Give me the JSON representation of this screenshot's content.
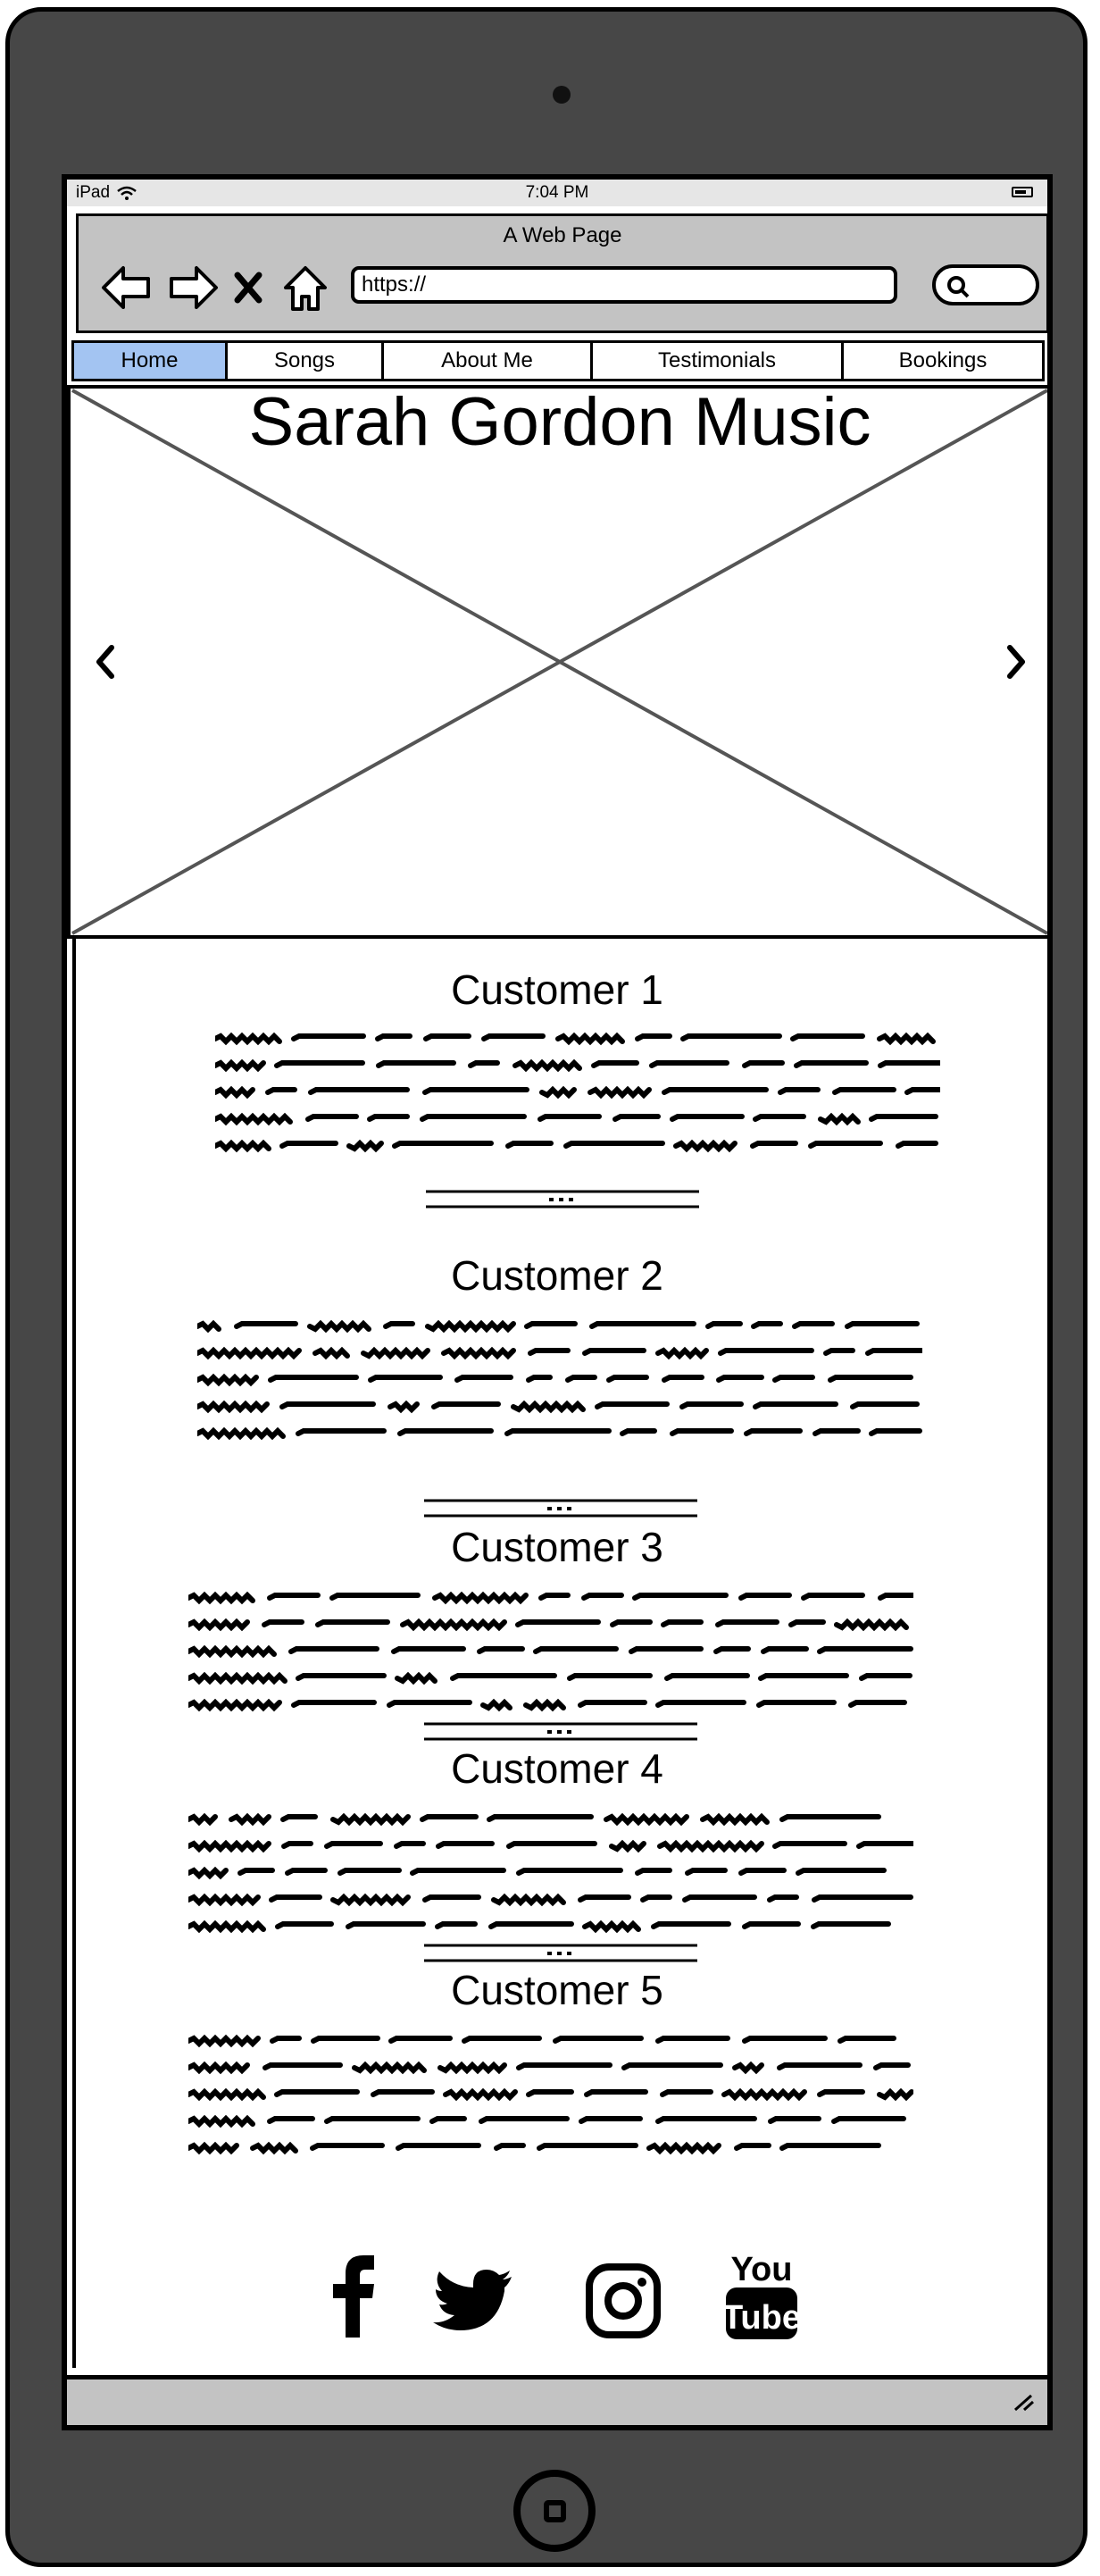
{
  "status_bar": {
    "device": "iPad",
    "time": "7:04 PM"
  },
  "browser": {
    "page_title": "A Web Page",
    "url": "https://",
    "icons": [
      "back-arrow-icon",
      "forward-arrow-icon",
      "stop-icon",
      "home-icon",
      "search-icon"
    ]
  },
  "nav": {
    "items": [
      {
        "label": "Home",
        "active": true
      },
      {
        "label": "Songs",
        "active": false
      },
      {
        "label": "About Me",
        "active": false
      },
      {
        "label": "Testimonials",
        "active": false
      },
      {
        "label": "Bookings",
        "active": false
      }
    ],
    "active_color": "#a3c4f2"
  },
  "hero": {
    "title": "Sarah Gordon Music",
    "icons": [
      "chevron-left-icon",
      "chevron-right-icon"
    ]
  },
  "testimonials": [
    {
      "name": "Customer 1"
    },
    {
      "name": "Customer 2"
    },
    {
      "name": "Customer 3"
    },
    {
      "name": "Customer 4"
    },
    {
      "name": "Customer 5"
    }
  ],
  "social": {
    "icons": [
      "facebook-icon",
      "twitter-icon",
      "instagram-icon",
      "youtube-icon"
    ],
    "youtube_you": "You",
    "youtube_tube": "Tube"
  },
  "colors": {
    "device_body": "#474747",
    "browser_chrome": "#c3c3c3",
    "status_bar": "#e6e6e6"
  }
}
